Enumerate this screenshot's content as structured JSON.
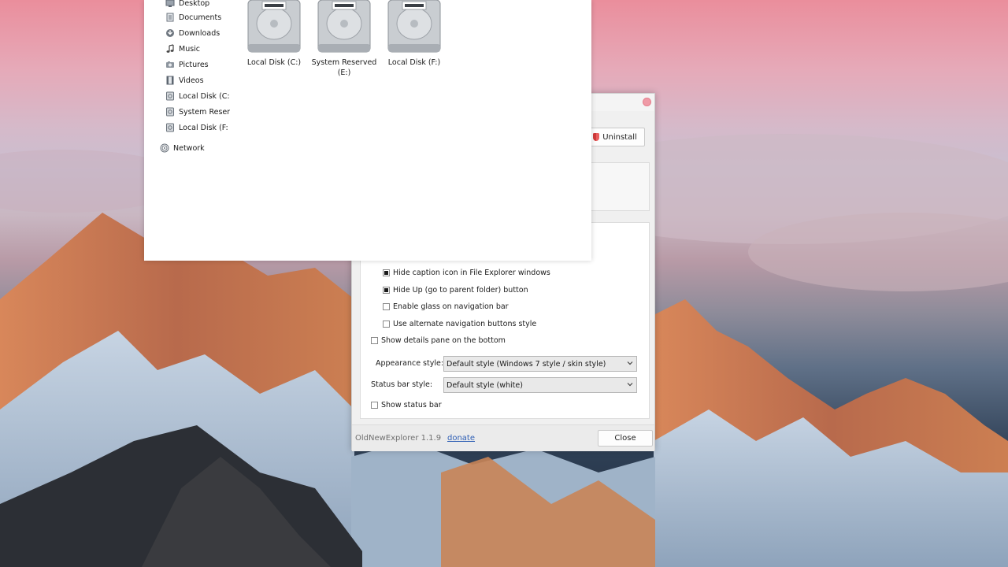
{
  "explorer": {
    "nav": [
      {
        "label": "Desktop",
        "icon": "desktop-icon"
      },
      {
        "label": "Documents",
        "icon": "documents-icon"
      },
      {
        "label": "Downloads",
        "icon": "downloads-icon"
      },
      {
        "label": "Music",
        "icon": "music-icon"
      },
      {
        "label": "Pictures",
        "icon": "pictures-icon"
      },
      {
        "label": "Videos",
        "icon": "videos-icon"
      },
      {
        "label": "Local Disk (C:",
        "icon": "drive-icon"
      },
      {
        "label": "System Reser",
        "icon": "drive-icon"
      },
      {
        "label": "Local Disk (F:",
        "icon": "drive-icon"
      },
      {
        "label": "Network",
        "icon": "network-icon"
      }
    ],
    "drives": [
      {
        "label": "Local Disk (C:)"
      },
      {
        "label": "System Reserved (E:)"
      },
      {
        "label": "Local Disk (F:)"
      }
    ]
  },
  "dialog": {
    "uninstall_label": "Uninstall",
    "checkboxes": [
      {
        "label": "Hide caption icon in File Explorer windows",
        "checked": true
      },
      {
        "label": "Hide Up (go to parent folder) button",
        "checked": true
      },
      {
        "label": "Enable glass on navigation bar",
        "checked": false
      },
      {
        "label": "Use alternate navigation buttons style",
        "checked": false
      },
      {
        "label": "Show details pane on the bottom",
        "checked": false
      },
      {
        "label": "Show status bar",
        "checked": false
      }
    ],
    "appearance_label": "Appearance style:",
    "appearance_value": "Default style (Windows 7 style / skin style)",
    "statusbar_label": "Status bar style:",
    "statusbar_value": "Default style (white)",
    "version": "OldNewExplorer 1.1.9",
    "donate_label": "donate",
    "close_label": "Close"
  },
  "colors": {
    "close_dot": "#ef9aa6",
    "link": "#2f5fb5"
  }
}
